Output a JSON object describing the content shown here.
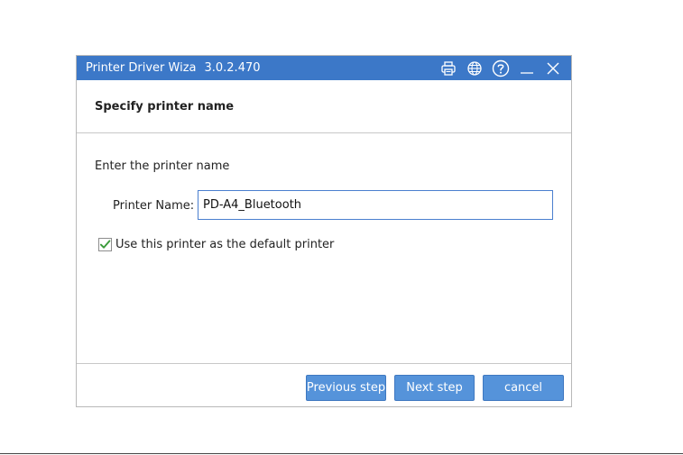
{
  "window": {
    "title": "Printer Driver Wiza",
    "version": "3.0.2.470",
    "icons": [
      "printer-icon",
      "globe-icon",
      "help-icon",
      "minimize-icon",
      "close-icon"
    ]
  },
  "header": {
    "title": "Specify printer name"
  },
  "content": {
    "instruction": "Enter the printer name",
    "printer_name_label": "Printer Name:",
    "printer_name_value": "PD-A4_Bluetooth",
    "default_checkbox_label": "Use this printer as the default printer",
    "default_checked": true
  },
  "footer": {
    "previous_label": "Previous step",
    "next_label": "Next step",
    "cancel_label": "cancel"
  },
  "colors": {
    "titlebar": "#3c78c8",
    "button": "#5593da",
    "checkmark": "#3a9b3a",
    "input_border": "#4a7fcf"
  }
}
